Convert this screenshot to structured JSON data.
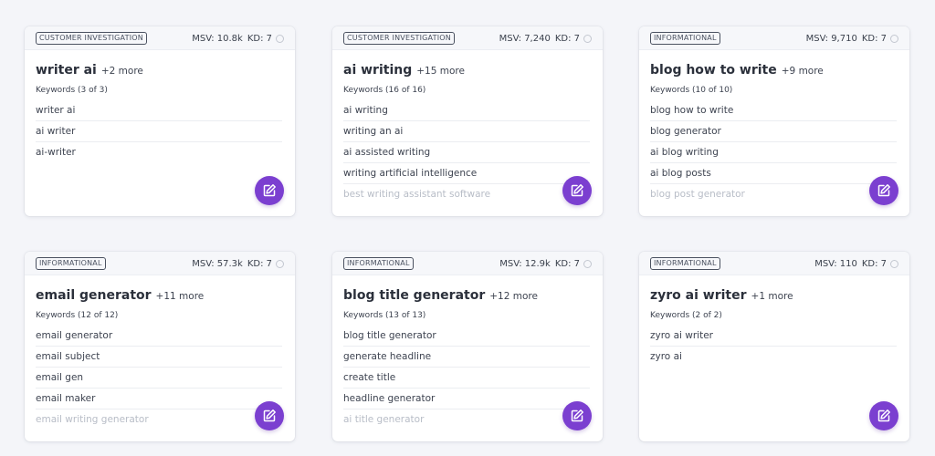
{
  "colors": {
    "accent": "#7b3fd0",
    "page_background": "#f4f5f9",
    "card_background": "#ffffff",
    "faded_text": "#b8bdc7"
  },
  "cards": [
    {
      "intent": "CUSTOMER INVESTIGATION",
      "msv": "MSV: 10.8k",
      "kd": "KD: 7",
      "title": "writer ai",
      "more": "+2 more",
      "keyword_count": "Keywords (3 of 3)",
      "keywords": [
        "writer ai",
        "ai writer",
        "ai-writer"
      ],
      "edit_icon": "edit-icon"
    },
    {
      "intent": "CUSTOMER INVESTIGATION",
      "msv": "MSV: 7,240",
      "kd": "KD: 7",
      "title": "ai writing",
      "more": "+15 more",
      "keyword_count": "Keywords (16 of 16)",
      "keywords": [
        "ai writing",
        "writing an ai",
        "ai assisted writing",
        "writing artificial intelligence",
        "best writing assistant software"
      ],
      "edit_icon": "edit-icon"
    },
    {
      "intent": "INFORMATIONAL",
      "msv": "MSV: 9,710",
      "kd": "KD: 7",
      "title": "blog how to write",
      "more": "+9 more",
      "keyword_count": "Keywords (10 of 10)",
      "keywords": [
        "blog how to write",
        "blog generator",
        "ai blog writing",
        "ai blog posts",
        "blog post generator"
      ],
      "edit_icon": "edit-icon"
    },
    {
      "intent": "INFORMATIONAL",
      "msv": "MSV: 57.3k",
      "kd": "KD: 7",
      "title": "email generator",
      "more": "+11 more",
      "keyword_count": "Keywords (12 of 12)",
      "keywords": [
        "email generator",
        "email subject",
        "email gen",
        "email maker",
        "email writing generator"
      ],
      "edit_icon": "edit-icon"
    },
    {
      "intent": "INFORMATIONAL",
      "msv": "MSV: 12.9k",
      "kd": "KD: 7",
      "title": "blog title generator",
      "more": "+12 more",
      "keyword_count": "Keywords (13 of 13)",
      "keywords": [
        "blog title generator",
        "generate headline",
        "create title",
        "headline generator",
        "ai title generator"
      ],
      "edit_icon": "edit-icon"
    },
    {
      "intent": "INFORMATIONAL",
      "msv": "MSV: 110",
      "kd": "KD: 7",
      "title": "zyro ai writer",
      "more": "+1 more",
      "keyword_count": "Keywords (2 of 2)",
      "keywords": [
        "zyro ai writer",
        "zyro ai"
      ],
      "edit_icon": "edit-icon"
    }
  ]
}
